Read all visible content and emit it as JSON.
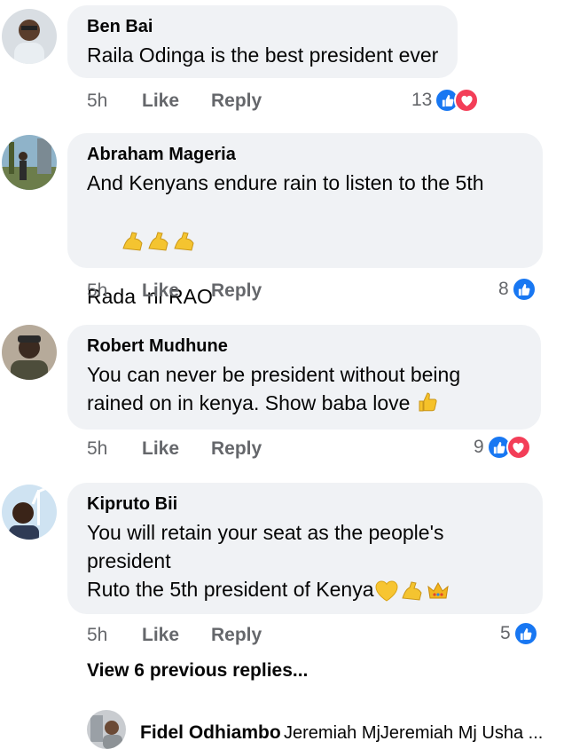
{
  "comments": [
    {
      "author": "Ben Bai",
      "lines": [
        "Raila Odinga is the best president ever"
      ],
      "time": "5h",
      "like": "Like",
      "reply": "Reply",
      "reaction_count": "13",
      "reactions": [
        "like-icon",
        "love-icon"
      ]
    },
    {
      "author": "Abraham Mageria",
      "lines": [
        "And Kenyans endure rain to listen to the 5th",
        "Rada  ni RAO"
      ],
      "emojis": [
        "flexed-biceps",
        "flexed-biceps",
        "flexed-biceps"
      ],
      "time": "5h",
      "like": "Like",
      "reply": "Reply",
      "reaction_count": "8",
      "reactions": [
        "like-icon"
      ]
    },
    {
      "author": "Robert Mudhune",
      "lines": [
        "You can never be president without being",
        "rained on in kenya. Show baba love"
      ],
      "emojis": [
        "thumbs-up"
      ],
      "time": "5h",
      "like": "Like",
      "reply": "Reply",
      "reaction_count": "9",
      "reactions": [
        "like-icon",
        "love-icon"
      ]
    },
    {
      "author": "Kipruto Bii",
      "lines": [
        "You will retain your seat as the people's",
        "president",
        "Ruto the 5th president of Kenya"
      ],
      "emojis": [
        "yellow-heart",
        "flexed-biceps",
        "crown"
      ],
      "time": "5h",
      "like": "Like",
      "reply": "Reply",
      "reaction_count": "5",
      "reactions": [
        "like-icon"
      ]
    }
  ],
  "view_replies": "View 6 previous replies...",
  "latest_reply": {
    "author": "Fidel Odhiambo",
    "text": "Jeremiah MjJeremiah Mj Usha ..."
  },
  "colors": {
    "like": "#1877f2",
    "love": "#f33e58",
    "bubble": "#f0f2f5",
    "meta": "#65676b"
  }
}
